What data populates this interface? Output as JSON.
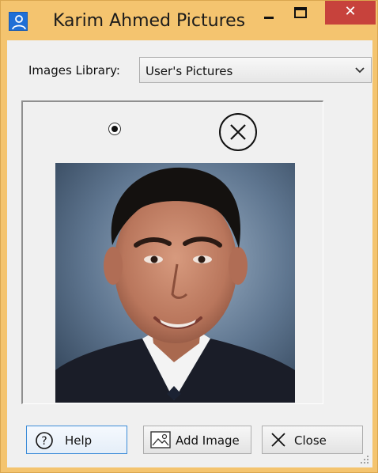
{
  "window": {
    "title": "Karim Ahmed Pictures",
    "title_icon": "user-icon",
    "controls": {
      "minimize": "–",
      "maximize": "☐",
      "close": "✕"
    },
    "accent_color": "#f4c46f",
    "close_color": "#c7423c"
  },
  "library": {
    "label": "Images Library:",
    "selected": "User's Pictures"
  },
  "viewer": {
    "default_radio_selected": true,
    "remove_icon": "circle-x-icon",
    "photo_alt": "Portrait photo"
  },
  "buttons": {
    "help": {
      "label": "Help",
      "icon": "question-circle-icon"
    },
    "add_image": {
      "label": "Add Image",
      "icon": "picture-icon"
    },
    "close": {
      "label": "Close",
      "icon": "x-icon"
    }
  }
}
